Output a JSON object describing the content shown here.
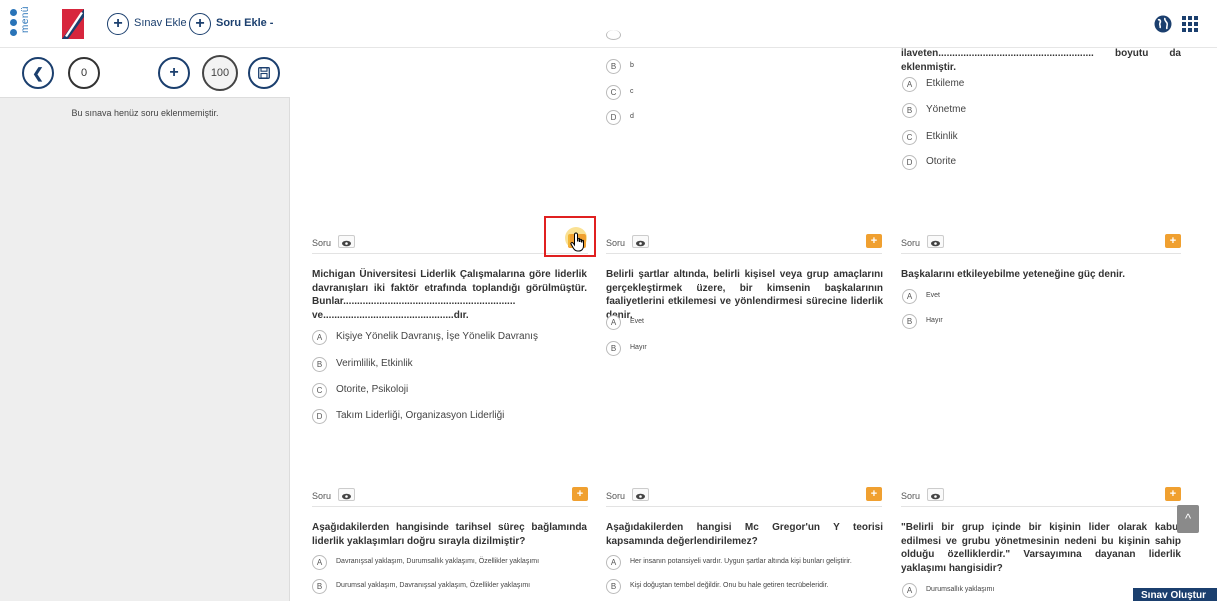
{
  "topbar": {
    "menu_label": "menü",
    "add_exam_label": "Sınav Ekle",
    "add_question_label": "Soru Ekle -"
  },
  "left_panel": {
    "count": "0",
    "total": "100",
    "empty_message": "Bu sınava henüz soru eklenmemiştir."
  },
  "colors": {
    "accent": "#1b3f6e",
    "add_button": "#f0a030",
    "highlight": "#e02020"
  },
  "top_cards": {
    "middle": {
      "options": [
        {
          "letter": "B",
          "text": "b"
        },
        {
          "letter": "C",
          "text": "c"
        },
        {
          "letter": "D",
          "text": "d"
        }
      ]
    },
    "right": {
      "text_line1_a": "ilaveten........................................................",
      "text_line1_b": "boyutu",
      "text_line1_c": "da",
      "text_line2": "eklenmiştir.",
      "options": [
        {
          "letter": "A",
          "text": "Etkileme"
        },
        {
          "letter": "B",
          "text": "Yönetme"
        },
        {
          "letter": "C",
          "text": "Etkinlik"
        },
        {
          "letter": "D",
          "text": "Otorite"
        }
      ]
    }
  },
  "cards_row2": [
    {
      "header": "Soru",
      "question": "Michigan Üniversitesi Liderlik Çalışmalarına göre liderlik davranışları iki faktör etrafında toplandığı görülmüştür. Bunlar.............................................................. ve...............................................dır.",
      "options": [
        {
          "letter": "A",
          "text": "Kişiye Yönelik Davranış, İşe Yönelik Davranış"
        },
        {
          "letter": "B",
          "text": "Verimlilik, Etkinlik"
        },
        {
          "letter": "C",
          "text": "Otorite, Psikoloji"
        },
        {
          "letter": "D",
          "text": "Takım Liderliği, Organizasyon Liderliği"
        }
      ]
    },
    {
      "header": "Soru",
      "question": "Belirli şartlar altında, belirli kişisel veya grup amaçlarını gerçekleştirmek üzere, bir kimsenin başkalarının faaliyetlerini etkilemesi ve yönlendirmesi sürecine liderlik denir.",
      "options": [
        {
          "letter": "A",
          "text": "Evet"
        },
        {
          "letter": "B",
          "text": "Hayır"
        }
      ]
    },
    {
      "header": "Soru",
      "question": "Başkalarını etkileyebilme yeteneğine güç denir.",
      "options": [
        {
          "letter": "A",
          "text": "Evet"
        },
        {
          "letter": "B",
          "text": "Hayır"
        }
      ]
    }
  ],
  "cards_row3": [
    {
      "header": "Soru",
      "question": "Aşağıdakilerden hangisinde tarihsel süreç bağlamında liderlik yaklaşımları doğru sırayla dizilmiştir?",
      "options": [
        {
          "letter": "A",
          "text": "Davranışsal yaklaşım, Durumsallık yaklaşımı, Özellikler yaklaşımı"
        },
        {
          "letter": "B",
          "text": "Durumsal yaklaşım, Davranışsal yaklaşım, Özellikler yaklaşımı"
        }
      ]
    },
    {
      "header": "Soru",
      "question": "Aşağıdakilerden hangisi Mc Gregor'un Y teorisi kapsamında değerlendirilemez?",
      "options": [
        {
          "letter": "A",
          "text": "Her insanın potansiyeli vardır. Uygun şartlar altında kişi bunları geliştirir."
        },
        {
          "letter": "B",
          "text": "Kişi doğuştan tembel değildir. Onu bu hale getiren tecrübeleridir."
        }
      ]
    },
    {
      "header": "Soru",
      "question": "\"Belirli bir grup içinde bir kişinin lider olarak kabul edilmesi ve grubu yönetmesinin nedeni bu kişinin sahip olduğu özelliklerdir.\" Varsayımına dayanan liderlik yaklaşımı hangisidir?",
      "options": [
        {
          "letter": "A",
          "text": "Durumsallık yaklaşımı"
        }
      ]
    }
  ],
  "create_exam_label": "Sınav Oluştur"
}
